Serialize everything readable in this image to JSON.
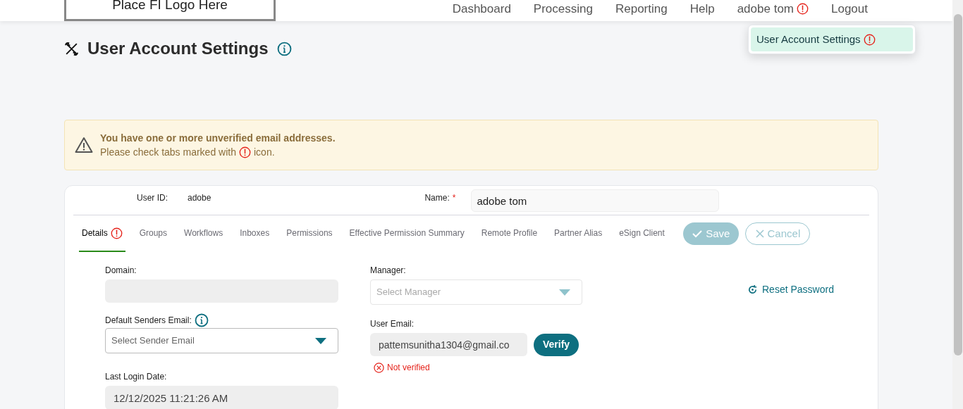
{
  "header": {
    "logo": "Place FI Logo Here",
    "nav": [
      {
        "label": "Dashboard",
        "kind": "link"
      },
      {
        "label": "Processing",
        "kind": "link"
      },
      {
        "label": "Reporting",
        "kind": "link"
      },
      {
        "label": "Help",
        "kind": "link"
      },
      {
        "label": "adobe tom",
        "kind": "user",
        "warning": true
      },
      {
        "label": "Logout",
        "kind": "link"
      }
    ],
    "user_menu": [
      {
        "label": "User Account Settings",
        "selected": true,
        "warning": true
      }
    ]
  },
  "page_title": "User Account Settings",
  "alert": {
    "title": "You have one or more unverified email addresses.",
    "message_before": "Please check tabs marked with",
    "message_after": "icon."
  },
  "user_id": {
    "label": "User ID:",
    "value": "adobe"
  },
  "name": {
    "label": "Name:",
    "required_mark": "*",
    "value": "adobe tom"
  },
  "tabs": [
    {
      "label": "Details",
      "selected": true,
      "warning": true
    },
    {
      "label": "Groups",
      "selected": false,
      "warning": false
    },
    {
      "label": "Workflows",
      "selected": false,
      "warning": false
    },
    {
      "label": "Inboxes",
      "selected": false,
      "warning": false
    },
    {
      "label": "Permissions",
      "selected": false,
      "warning": false
    },
    {
      "label": "Effective Permission Summary",
      "selected": false,
      "warning": false
    },
    {
      "label": "Remote Profile",
      "selected": false,
      "warning": false
    },
    {
      "label": "Partner Alias",
      "selected": false,
      "warning": false
    },
    {
      "label": "eSign Client",
      "selected": false,
      "warning": false
    }
  ],
  "actions": {
    "save": {
      "label": "Save",
      "disabled": true
    },
    "cancel": {
      "label": "Cancel",
      "disabled": true
    }
  },
  "fields": {
    "domain": {
      "label": "Domain:"
    },
    "default_senders_email": {
      "label": "Default Senders Email:",
      "placeholder": "Select Sender Email"
    },
    "last_login_date": {
      "label": "Last Login Date:",
      "value": "12/12/2025 11:21:26 AM"
    },
    "manager": {
      "label": "Manager:",
      "placeholder": "Select Manager",
      "disabled": true
    },
    "user_email": {
      "label": "User Email:",
      "value": "pattemsunitha1304@gmail.co",
      "verify": "Verify",
      "status": "Not verified"
    }
  },
  "reset_password": "Reset Password"
}
